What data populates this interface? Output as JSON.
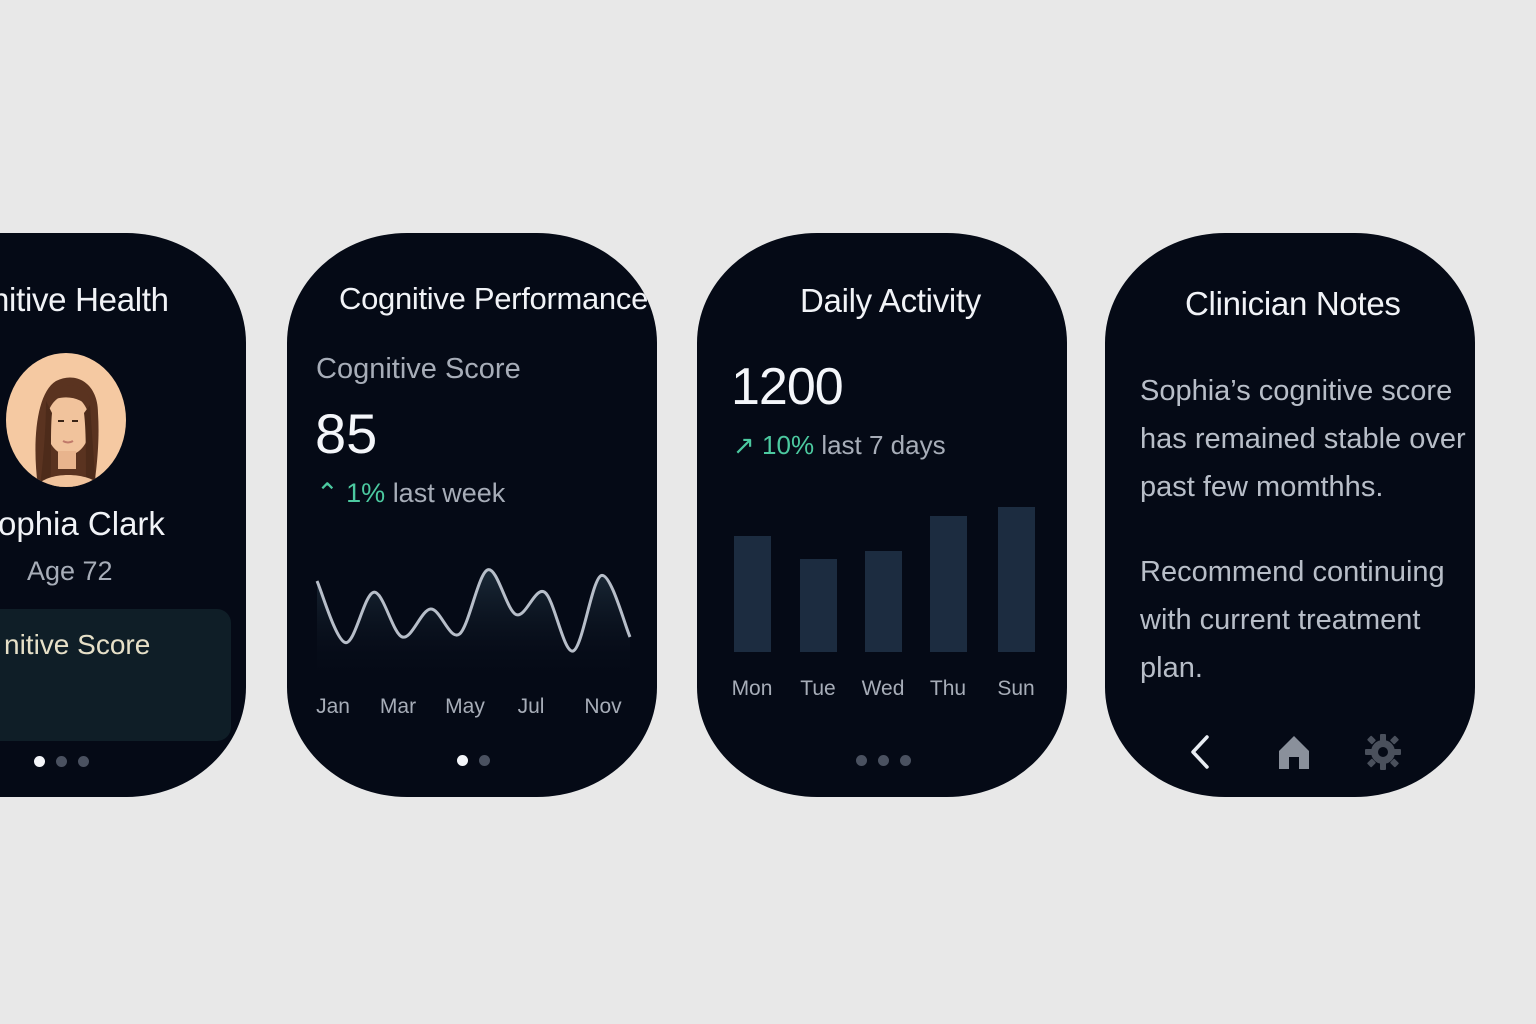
{
  "screens": [
    {
      "title": "nitive Health",
      "name": "ophia Clark",
      "age": "Age 72",
      "card_label": "nitive Score",
      "dots": {
        "count": 3,
        "active": 0
      }
    },
    {
      "title": "Cognitive Performance",
      "score_label": "Cognitive Score",
      "score_value": "85",
      "change_pct": "1%",
      "change_period": "last week",
      "dots": {
        "count": 2,
        "active": 0
      }
    },
    {
      "title": "Daily Activity",
      "steps_value": "1200",
      "change_pct": "10%",
      "change_period": "last 7 days",
      "dots": {
        "count": 3,
        "active": -1
      }
    },
    {
      "title": "Clinician Notes",
      "note_1": "Sophia’s cognitive score has remained stable over past few momthhs.",
      "note_2": "Recommend continuing with current treatment plan.",
      "nav": {
        "back": "chevron-left-icon",
        "home": "home-icon",
        "settings": "gear-icon"
      }
    }
  ],
  "colors": {
    "accent": "#4cc9a0",
    "screen_bg": "#050a16",
    "bar": "#1c2c40",
    "line": "#b7bec9"
  },
  "chart_data": [
    {
      "type": "line",
      "categories": [
        "Jan",
        "Mar",
        "May",
        "Jul",
        "Nov"
      ],
      "values": [
        80,
        58,
        76,
        60,
        70,
        61,
        84,
        68,
        76,
        55,
        82,
        60
      ],
      "title": "",
      "xlabel": "",
      "ylabel": "",
      "grid": false
    },
    {
      "type": "bar",
      "categories": [
        "Mon",
        "Tue",
        "Wed",
        "Thu",
        "Sun"
      ],
      "values": [
        116,
        93,
        101,
        136,
        145
      ],
      "title": "",
      "xlabel": "",
      "ylabel": "",
      "grid": false
    }
  ]
}
